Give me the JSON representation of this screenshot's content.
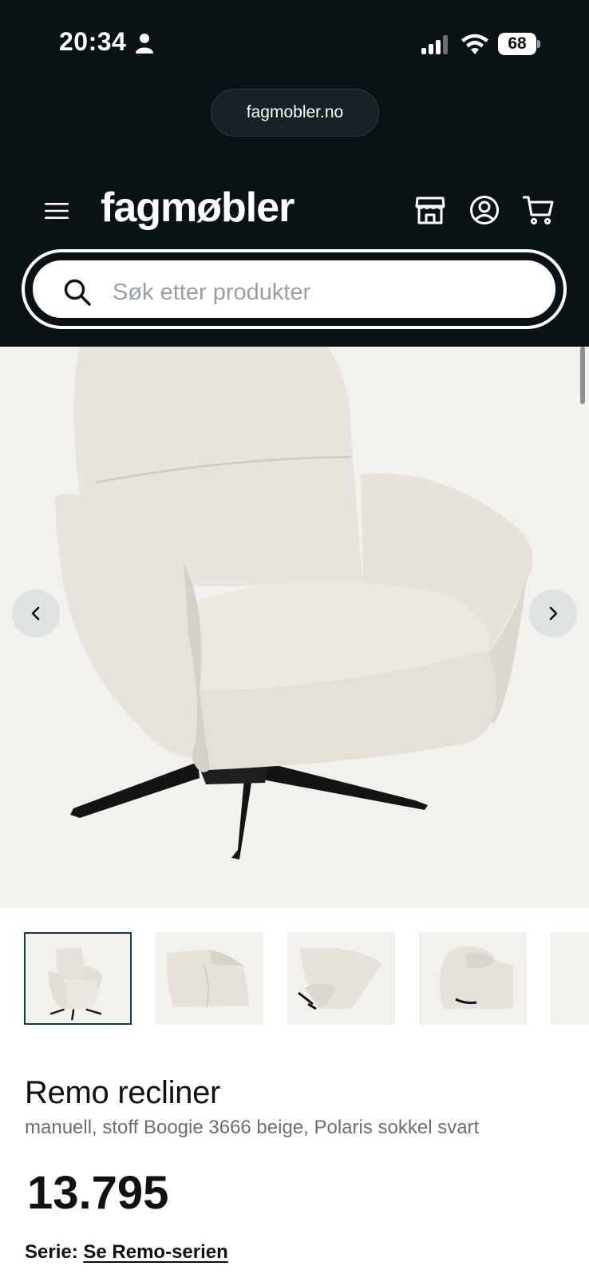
{
  "status_bar": {
    "time": "20:34",
    "battery_level": "68",
    "icons": [
      "person-icon",
      "signal-icon",
      "wifi-icon",
      "battery-icon"
    ]
  },
  "browser": {
    "url": "fagmobler.no"
  },
  "header": {
    "logo": "fagmøbler",
    "icons": [
      "menu-icon",
      "store-icon",
      "account-icon",
      "cart-icon"
    ]
  },
  "search": {
    "placeholder": "Søk etter produkter",
    "value": ""
  },
  "gallery": {
    "image": "recliner-chair-beige",
    "prev_icon": "chevron-left-icon",
    "next_icon": "chevron-right-icon",
    "thumbnails_visible": 5,
    "active_thumbnail": 1
  },
  "product": {
    "title": "Remo recliner",
    "variant": "manuell, stoff Boogie 3666 beige, Polaris sokkel svart",
    "price": "13.795",
    "series_label": "Serie:",
    "series_link": "Se Remo-serien"
  },
  "colors": {
    "header_bg": "#0b1216",
    "gallery_bg": "#f2f1ee",
    "active_thumb_border": "#1c3a4a",
    "chair_fabric": "#e9e5de"
  }
}
